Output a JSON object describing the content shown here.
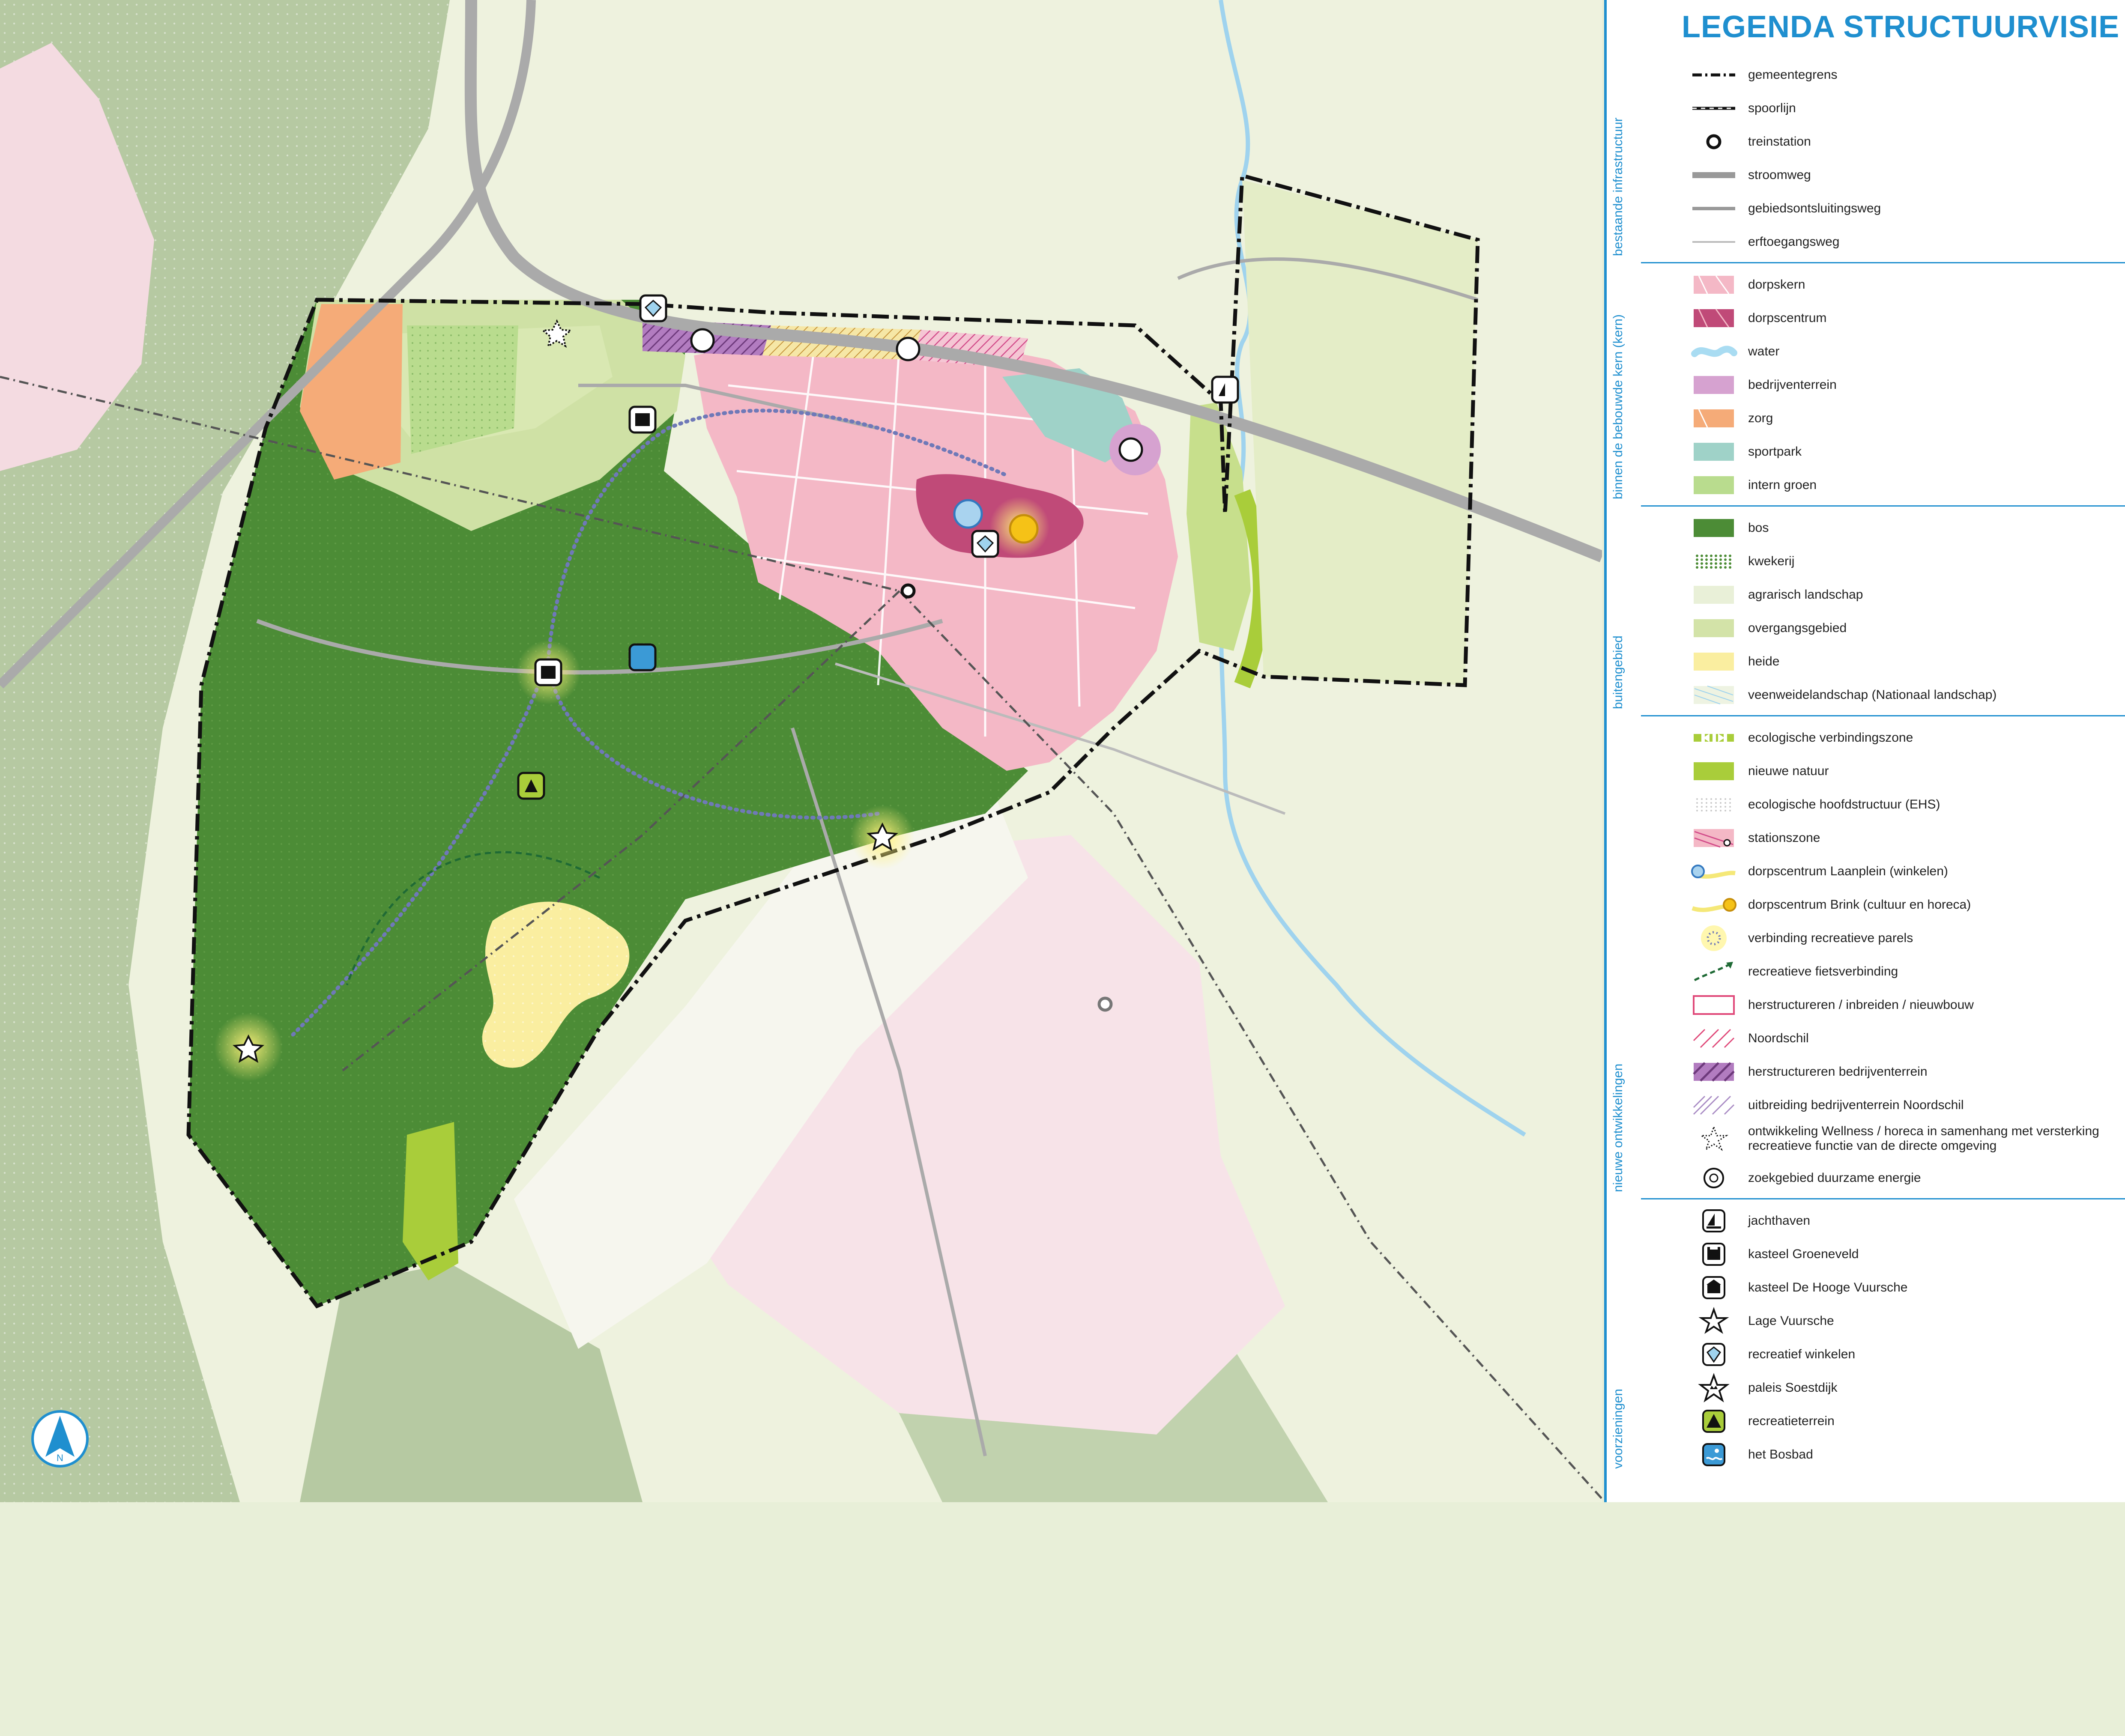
{
  "legend": {
    "title": "LEGENDA STRUCTUURVISIE",
    "groups": [
      {
        "label": "bestaande infrastructuur",
        "items": [
          {
            "symbol": "gemeentegrens-line",
            "label": "gemeentegrens"
          },
          {
            "symbol": "spoorlijn-line",
            "label": "spoorlijn"
          },
          {
            "symbol": "station-circle",
            "label": "treinstation"
          },
          {
            "symbol": "stroomweg-line",
            "label": "stroomweg"
          },
          {
            "symbol": "gebiedsontsluitingsweg-line",
            "label": "gebiedsontsluitingsweg"
          },
          {
            "symbol": "erftoegangsweg-line",
            "label": "erftoegangsweg"
          }
        ]
      },
      {
        "label": "binnen de bebouwde kern (kern)",
        "items": [
          {
            "symbol": "dorpskern-swatch",
            "label": "dorpskern"
          },
          {
            "symbol": "dorpscentrum-swatch",
            "label": "dorpscentrum"
          },
          {
            "symbol": "water-swatch",
            "label": "water"
          },
          {
            "symbol": "bedrijventerrein-swatch",
            "label": "bedrijventerrein"
          },
          {
            "symbol": "zorg-swatch",
            "label": "zorg"
          },
          {
            "symbol": "sportpark-swatch",
            "label": "sportpark"
          },
          {
            "symbol": "intern-groen-swatch",
            "label": "intern groen"
          }
        ]
      },
      {
        "label": "buitengebied",
        "items": [
          {
            "symbol": "bos-swatch",
            "label": "bos"
          },
          {
            "symbol": "kwekerij-swatch",
            "label": "kwekerij"
          },
          {
            "symbol": "agrarisch-swatch",
            "label": "agrarisch landschap"
          },
          {
            "symbol": "overgangsgebied-swatch",
            "label": "overgangsgebied"
          },
          {
            "symbol": "heide-swatch",
            "label": "heide"
          },
          {
            "symbol": "veenweide-swatch",
            "label": "veenweidelandschap (Nationaal landschap)"
          }
        ]
      },
      {
        "label": "nieuwe ontwikkelingen",
        "items": [
          {
            "symbol": "eco-verbindingszone",
            "label": "ecologische verbindingszone"
          },
          {
            "symbol": "nieuwe-natuur-swatch",
            "label": "nieuwe natuur"
          },
          {
            "symbol": "ehs-swatch",
            "label": "ecologische hoofdstructuur (EHS)"
          },
          {
            "symbol": "stationszone-swatch",
            "label": "stationszone"
          },
          {
            "symbol": "laanplein-marker",
            "label": "dorpscentrum Laanplein (winkelen)"
          },
          {
            "symbol": "brink-marker",
            "label": "dorpscentrum Brink (cultuur en horeca)"
          },
          {
            "symbol": "parels-marker",
            "label": "verbinding recreatieve parels"
          },
          {
            "symbol": "fietsverbinding-arrow",
            "label": "recreatieve fietsverbinding"
          },
          {
            "symbol": "herstructureren-outline",
            "label": "herstructureren / inbreiden / nieuwbouw"
          },
          {
            "symbol": "noordschil-hatch",
            "label": "Noordschil"
          },
          {
            "symbol": "herstructureren-bedrijf-hatch",
            "label": "herstructureren bedrijventerrein"
          },
          {
            "symbol": "uitbreiding-hatch",
            "label": "uitbreiding bedrijventerrein Noordschil"
          },
          {
            "symbol": "wellness-star",
            "label": "ontwikkeling Wellness / horeca in samenhang met versterking recreatieve functie van de directe omgeving"
          },
          {
            "symbol": "energie-icon",
            "label": "zoekgebied duurzame energie"
          }
        ]
      },
      {
        "label": "voorzieningen",
        "items": [
          {
            "symbol": "jachthaven-icon",
            "label": "jachthaven"
          },
          {
            "symbol": "kasteel-icon",
            "label": "kasteel Groeneveld"
          },
          {
            "symbol": "kasteel2-icon",
            "label": "kasteel De Hooge Vuursche"
          },
          {
            "symbol": "star-icon",
            "label": "Lage Vuursche"
          },
          {
            "symbol": "diamond-icon",
            "label": "recreatief winkelen"
          },
          {
            "symbol": "crown-star-icon",
            "label": "paleis Soestdijk"
          },
          {
            "symbol": "tent-icon",
            "label": "recreatieterrein"
          },
          {
            "symbol": "swim-icon",
            "label": "het Bosbad"
          }
        ]
      }
    ]
  },
  "north_arrow": {
    "label": "N"
  },
  "colors": {
    "accent": "#1f8fcf",
    "dorpskern": "#f4b8c6",
    "dorpscentrum": "#c04a78",
    "water": "#a9dcf2",
    "bedrijventerrein": "#d6a2d0",
    "zorg": "#f5ab78",
    "sportpark": "#9fd2c8",
    "intern_groen": "#b9dc8e",
    "bos": "#4c8c36",
    "agrarisch": "#e9f0d8",
    "overgangsgebied": "#d3e3a8",
    "heide": "#faeea0",
    "nieuwe_natuur": "#a9cd3a"
  }
}
